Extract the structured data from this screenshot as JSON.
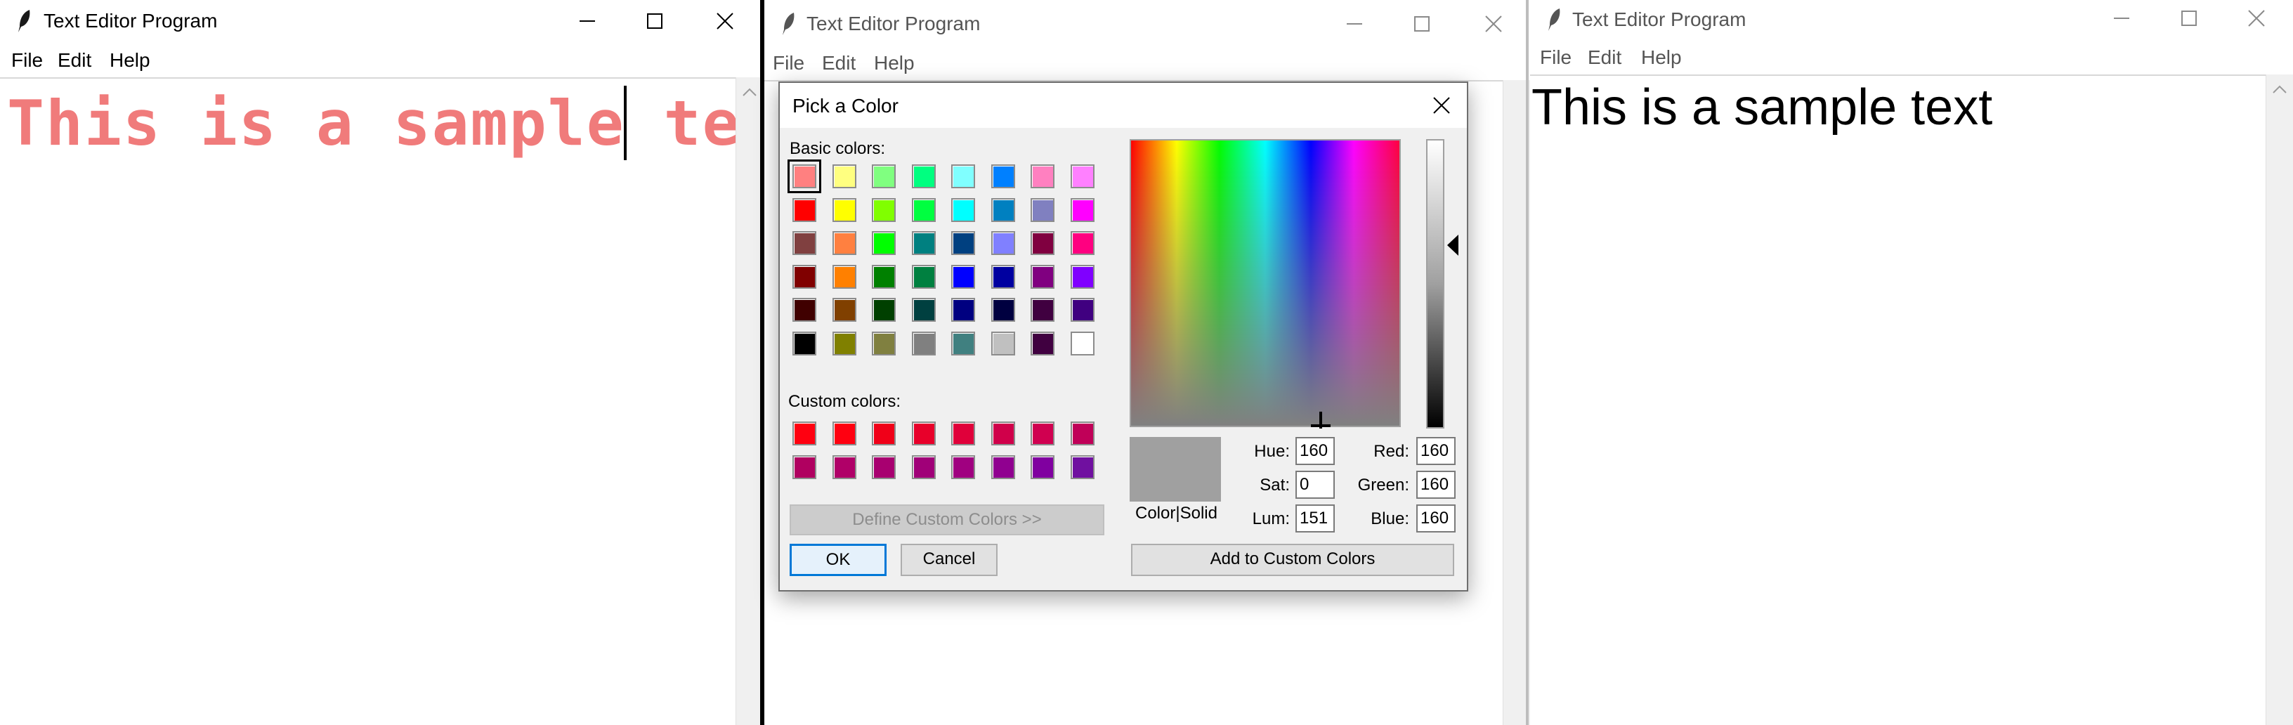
{
  "windows": [
    {
      "title": "Text Editor Program",
      "menu": [
        "File",
        "Edit",
        "Help"
      ],
      "content": "This is a sample text"
    },
    {
      "title": "Text Editor Program",
      "menu": [
        "File",
        "Edit",
        "Help"
      ]
    },
    {
      "title": "Text Editor Program",
      "menu": [
        "File",
        "Edit",
        "Help"
      ],
      "content": "This is a sample text"
    }
  ],
  "sample_text_color": "#f07b7b",
  "dialog": {
    "title": "Pick a Color",
    "basic_colors_label": "Basic colors:",
    "custom_colors_label": "Custom colors:",
    "define_custom_button": "Define Custom Colors >>",
    "ok_button": "OK",
    "cancel_button": "Cancel",
    "add_custom_button": "Add to Custom Colors",
    "preview_label": "Color|Solid",
    "selected_swatch": 0,
    "fields": {
      "hue_label": "Hue:",
      "hue": "160",
      "sat_label": "Sat:",
      "sat": "0",
      "lum_label": "Lum:",
      "lum": "151",
      "red_label": "Red:",
      "red": "160",
      "green_label": "Green:",
      "green": "160",
      "blue_label": "Blue:",
      "blue": "160"
    },
    "basic_colors": [
      [
        "#ff8080",
        "#ffff80",
        "#80ff80",
        "#00ff80",
        "#80ffff",
        "#0080ff",
        "#ff80c0",
        "#ff80ff"
      ],
      [
        "#ff0000",
        "#ffff00",
        "#80ff00",
        "#00ff40",
        "#00ffff",
        "#0080c0",
        "#8080c0",
        "#ff00ff"
      ],
      [
        "#804040",
        "#ff8040",
        "#00ff00",
        "#008080",
        "#004080",
        "#8080ff",
        "#800040",
        "#ff0080"
      ],
      [
        "#800000",
        "#ff8000",
        "#008000",
        "#008040",
        "#0000ff",
        "#0000a0",
        "#800080",
        "#8000ff"
      ],
      [
        "#400000",
        "#804000",
        "#004000",
        "#004040",
        "#000080",
        "#000040",
        "#400040",
        "#400080"
      ],
      [
        "#000000",
        "#808000",
        "#808040",
        "#808080",
        "#408080",
        "#c0c0c0",
        "#400040",
        "#ffffff"
      ]
    ],
    "custom_colors": [
      [
        "#ff0010",
        "#ff0010",
        "#f00018",
        "#e8002a",
        "#e0003a",
        "#d0004a",
        "#d00050",
        "#c00058"
      ],
      [
        "#b00060",
        "#b00068",
        "#a80070",
        "#a00078",
        "#a00080",
        "#900090",
        "#8000a0",
        "#7010a0"
      ]
    ]
  }
}
